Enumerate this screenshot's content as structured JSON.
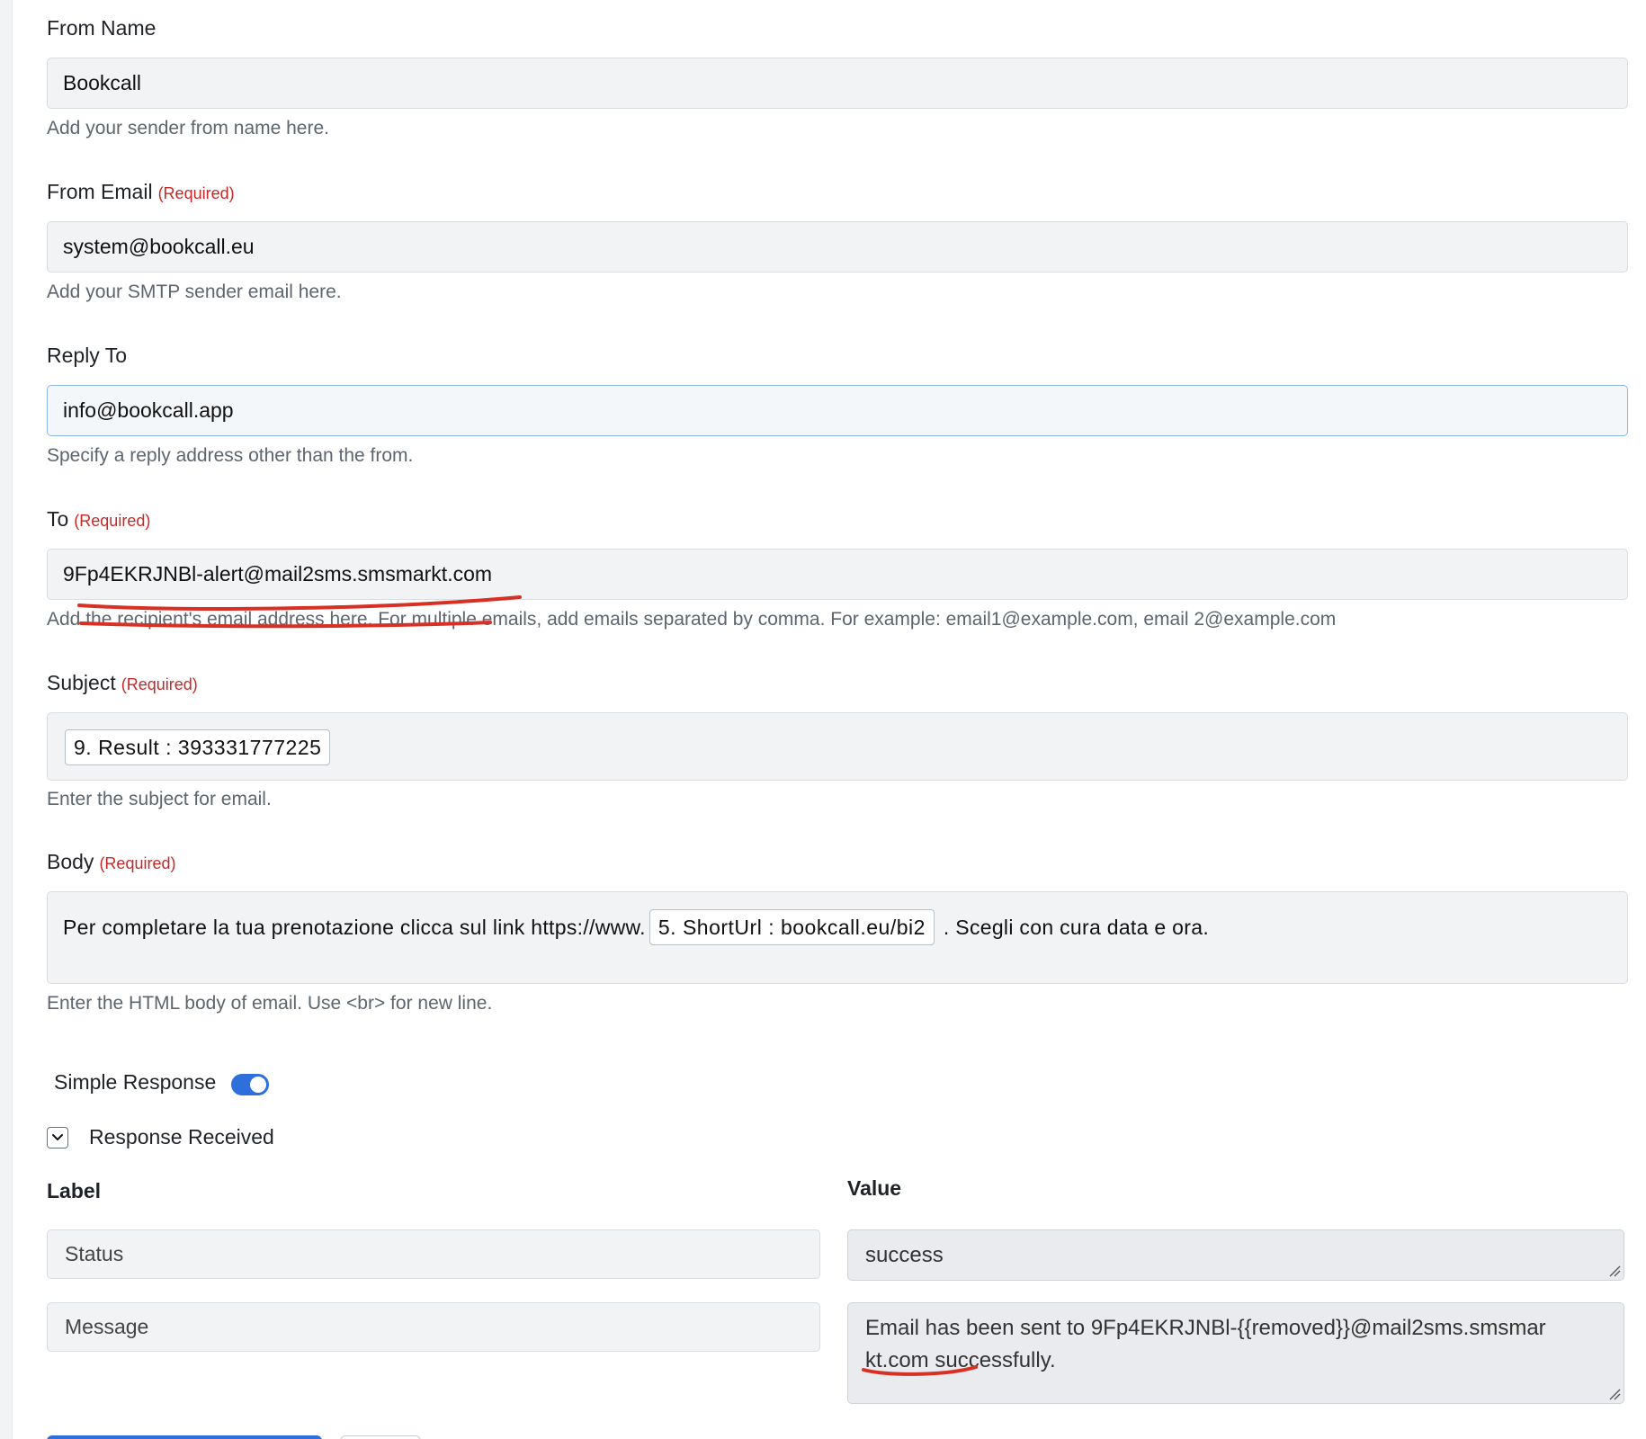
{
  "fields": {
    "from_name": {
      "label": "From Name",
      "value": "Bookcall",
      "help": "Add your sender from name here."
    },
    "from_email": {
      "label": "From Email",
      "required": "(Required)",
      "value": "system@bookcall.eu",
      "help": "Add your SMTP sender email here."
    },
    "reply_to": {
      "label": "Reply To",
      "value": "info@bookcall.app",
      "help": "Specify a reply address other than the from."
    },
    "to": {
      "label": "To",
      "required": "(Required)",
      "value": "9Fp4EKRJNBl-alert@mail2sms.smsmarkt.com",
      "help": "Add the recipient's email address here. For multiple emails, add emails separated by comma. For example: email1@example.com, email 2@example.com"
    },
    "subject": {
      "label": "Subject",
      "required": "(Required)",
      "token": "9. Result : 393331777225",
      "help": "Enter the subject for email."
    },
    "body": {
      "label": "Body",
      "required": "(Required)",
      "text_before": "Per completare la tua prenotazione clicca sul link https://www.",
      "token": "5. ShortUrl : bookcall.eu/bi2",
      "text_after": ". Scegli con cura data e ora.",
      "help": "Enter the HTML body of email. Use <br> for new line."
    }
  },
  "simple_response": {
    "label": "Simple Response",
    "enabled": true
  },
  "response_received": {
    "label": "Response Received"
  },
  "response_table": {
    "label_header": "Label",
    "value_header": "Value",
    "rows": [
      {
        "label": "Status",
        "value": "success"
      },
      {
        "label": "Message",
        "value": "Email has been sent to 9Fp4EKRJNBl-{{removed}}@mail2sms.smsmarkt.com successfully."
      }
    ]
  },
  "colors": {
    "accent": "#2f6fdb",
    "required": "#c62828",
    "annotation": "#d93025"
  }
}
